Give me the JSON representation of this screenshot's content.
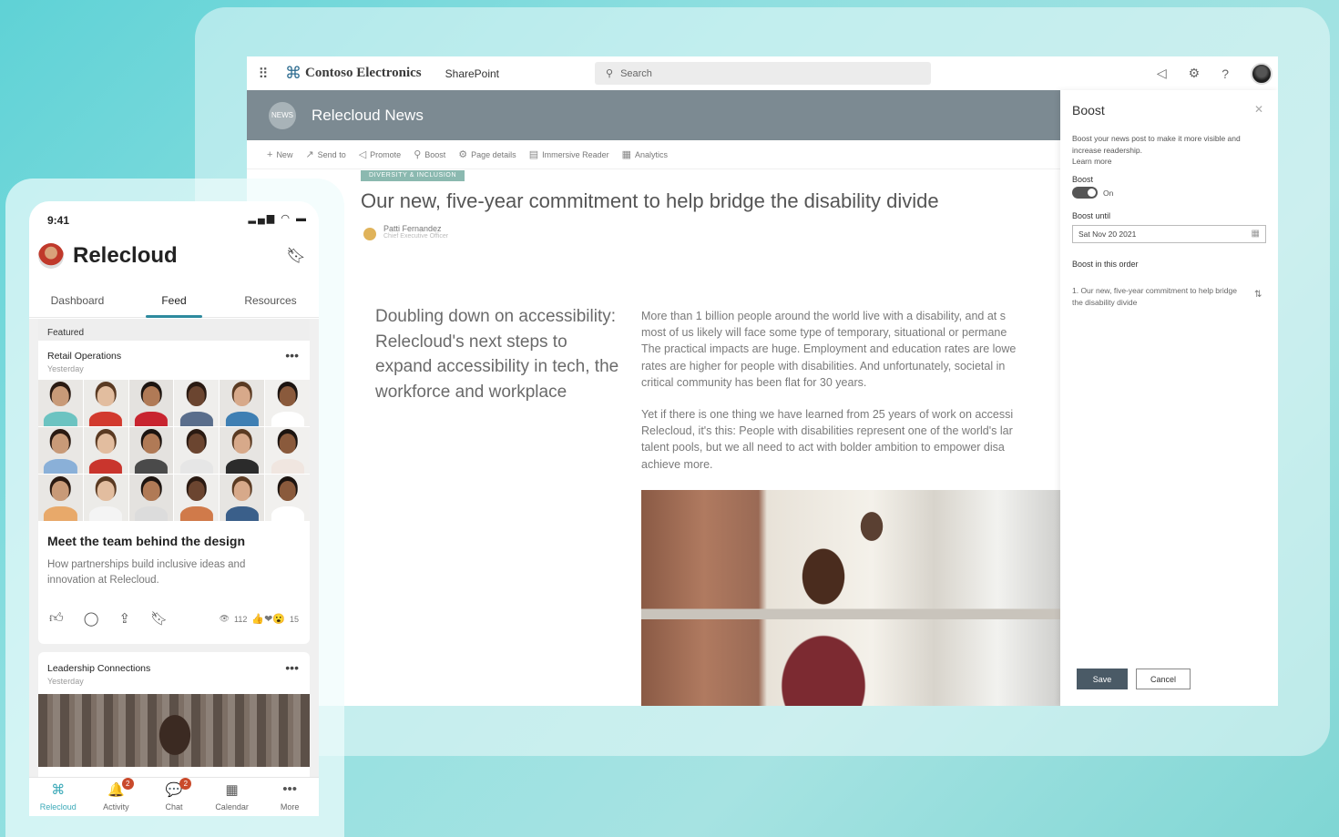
{
  "sharepoint": {
    "brand_name": "Contoso Electronics",
    "app_link": "SharePoint",
    "search_placeholder": "Search",
    "site": {
      "logo_text": "NEWS",
      "title": "Relecloud News"
    },
    "commands": [
      {
        "icon": "plus-icon",
        "glyph": "+",
        "label": "New"
      },
      {
        "icon": "send-icon",
        "glyph": "↗",
        "label": "Send to"
      },
      {
        "icon": "promote-icon",
        "glyph": "◁",
        "label": "Promote"
      },
      {
        "icon": "rocket-icon",
        "glyph": "⚲",
        "label": "Boost"
      },
      {
        "icon": "gear-icon",
        "glyph": "⚙",
        "label": "Page details"
      },
      {
        "icon": "reader-icon",
        "glyph": "▤",
        "label": "Immersive Reader"
      },
      {
        "icon": "chart-icon",
        "glyph": "▦",
        "label": "Analytics"
      }
    ],
    "article": {
      "category": "DIVERSITY & INCLUSION",
      "title": "Our new, five-year commitment to help bridge the disability divide",
      "author_name": "Patti Fernandez",
      "author_role": "Chief Executive Officer",
      "pull_quote": "Doubling down on accessibility: Relecloud's next steps to expand accessibility in tech, the workforce and workplace",
      "paragraph_1_lines": [
        "More than 1 billion people around the world live with a disability, and at s",
        "most of us likely will face some type of temporary, situational or permane",
        "The practical impacts are huge. Employment and education rates are lowe",
        "rates are higher for people with disabilities. And unfortunately, societal in",
        "critical community has been flat for 30 years."
      ],
      "paragraph_2_lines": [
        "Yet if there is one thing we have learned from 25 years of work on accessi",
        "Relecloud, it's this: People with disabilities represent one of the world's lar",
        "talent pools, but we all need to act with bolder ambition to empower disa",
        "achieve more."
      ]
    },
    "boost_panel": {
      "title": "Boost",
      "description": "Boost your news post to make it more visible and increase readership.",
      "learn_more": "Learn more",
      "toggle_label": "Boost",
      "toggle_state": "On",
      "until_label": "Boost until",
      "until_value": "Sat Nov 20 2021",
      "order_label": "Boost in this order",
      "order_item": "1. Our new, five-year commitment to help bridge the disability divide",
      "save": "Save",
      "cancel": "Cancel"
    }
  },
  "mobile": {
    "time": "9:41",
    "app_title": "Relecloud",
    "tabs": [
      "Dashboard",
      "Feed",
      "Resources"
    ],
    "active_tab": "Feed",
    "featured_label": "Featured",
    "card1": {
      "source": "Retail Operations",
      "date": "Yesterday",
      "title": "Meet the team behind the design",
      "desc": "How partnerships build inclusive ideas and innovation at Relecloud.",
      "views": "112",
      "reactions": "15"
    },
    "card2": {
      "source": "Leadership Connections",
      "date": "Yesterday"
    },
    "nav": [
      {
        "label": "Relecloud",
        "icon": "relecloud-icon",
        "glyph": "⌘",
        "badge": ""
      },
      {
        "label": "Activity",
        "icon": "bell-icon",
        "glyph": "🔔",
        "badge": "2"
      },
      {
        "label": "Chat",
        "icon": "chat-icon",
        "glyph": "💬",
        "badge": "2"
      },
      {
        "label": "Calendar",
        "icon": "calendar-icon",
        "glyph": "▦",
        "badge": ""
      },
      {
        "label": "More",
        "icon": "more-icon",
        "glyph": "•••",
        "badge": ""
      }
    ]
  },
  "colors": {
    "accent_teal": "#2d8a9e",
    "site_header": "#7c8a92",
    "badge": "#c94a2b",
    "save_button": "#4a5a66"
  }
}
